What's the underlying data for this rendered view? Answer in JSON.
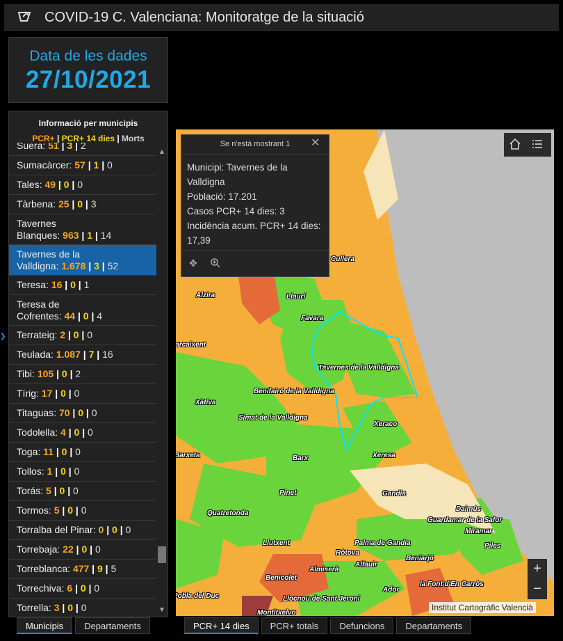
{
  "header": {
    "title": "COVID-19 C. Valenciana: Monitoratge de la situació",
    "logo_icon": "sword-icon"
  },
  "date_card": {
    "label": "Data de les dades",
    "value": "27/10/2021"
  },
  "panel": {
    "title": "Informació per municipis",
    "legend": {
      "pcr": "PCR+",
      "pcr14": "PCR+ 14 dies",
      "morts": "Morts",
      "sep": " | "
    },
    "rows": [
      {
        "name": "Suera",
        "a": "51",
        "b": "3",
        "c": "2",
        "two_line": false,
        "selected": false
      },
      {
        "name": "Sumacàrcer",
        "a": "57",
        "b": "1",
        "c": "0",
        "two_line": false,
        "selected": false
      },
      {
        "name": "Tales",
        "a": "49",
        "b": "0",
        "c": "0",
        "two_line": false,
        "selected": false
      },
      {
        "name": "Tàrbena",
        "a": "25",
        "b": "0",
        "c": "3",
        "two_line": false,
        "selected": false
      },
      {
        "name": "Tavernes\nBlanques",
        "a": "963",
        "b": "1",
        "c": "14",
        "two_line": true,
        "selected": false
      },
      {
        "name": "Tavernes de la\nValldigna",
        "a": "1.678",
        "b": "3",
        "c": "52",
        "two_line": true,
        "selected": true
      },
      {
        "name": "Teresa",
        "a": "16",
        "b": "0",
        "c": "1",
        "two_line": false,
        "selected": false
      },
      {
        "name": "Teresa de\nCofrentes",
        "a": "44",
        "b": "0",
        "c": "4",
        "two_line": true,
        "selected": false
      },
      {
        "name": "Terrateig",
        "a": "2",
        "b": "0",
        "c": "0",
        "two_line": false,
        "selected": false
      },
      {
        "name": "Teulada",
        "a": "1.087",
        "b": "7",
        "c": "16",
        "two_line": false,
        "selected": false
      },
      {
        "name": "Tibi",
        "a": "105",
        "b": "0",
        "c": "2",
        "two_line": false,
        "selected": false
      },
      {
        "name": "Tírig",
        "a": "17",
        "b": "0",
        "c": "0",
        "two_line": false,
        "selected": false
      },
      {
        "name": "Titaguas",
        "a": "70",
        "b": "0",
        "c": "0",
        "two_line": false,
        "selected": false
      },
      {
        "name": "Todolella",
        "a": "4",
        "b": "0",
        "c": "0",
        "two_line": false,
        "selected": false
      },
      {
        "name": "Toga",
        "a": "11",
        "b": "0",
        "c": "0",
        "two_line": false,
        "selected": false
      },
      {
        "name": "Tollos",
        "a": "1",
        "b": "0",
        "c": "0",
        "two_line": false,
        "selected": false
      },
      {
        "name": "Torás",
        "a": "5",
        "b": "0",
        "c": "0",
        "two_line": false,
        "selected": false
      },
      {
        "name": "Tormos",
        "a": "5",
        "b": "0",
        "c": "0",
        "two_line": false,
        "selected": false
      },
      {
        "name": "Torralba del Pinar",
        "a": "0",
        "b": "0",
        "c": "0",
        "two_line": false,
        "selected": false
      },
      {
        "name": "Torrebaja",
        "a": "22",
        "b": "0",
        "c": "0",
        "two_line": false,
        "selected": false
      },
      {
        "name": "Torreblanca",
        "a": "477",
        "b": "9",
        "c": "5",
        "two_line": false,
        "selected": false
      },
      {
        "name": "Torrechiva",
        "a": "6",
        "b": "0",
        "c": "0",
        "two_line": false,
        "selected": false
      },
      {
        "name": "Torrella",
        "a": "3",
        "b": "0",
        "c": "0",
        "two_line": false,
        "selected": false
      }
    ]
  },
  "left_tabs": [
    "Municipis",
    "Departaments"
  ],
  "map_tabs": [
    "PCR+ 14 dies",
    "PCR+ totals",
    "Defuncions",
    "Departaments"
  ],
  "popup": {
    "title": "Se n'està mostrant 1",
    "lines": [
      "Municipi: Tavernes de la Valldigna",
      "Població: 17.201",
      "Casos PCR+ 14 dies: 3",
      "Incidència acum. PCR+ 14 dies: 17,39"
    ]
  },
  "map": {
    "attribution": "Institut Cartogràfic Valencià",
    "zoom_in": "+",
    "zoom_out": "−",
    "labels": [
      "Cullera",
      "Alzira",
      "Llaurí",
      "Favara",
      "Carcaixent",
      "Tavernes de la Valldigna",
      "Benifairó de la Valldigna",
      "Xàtiva",
      "Simat de la Valldigna",
      "Xeraco",
      "Barxeta",
      "Barx",
      "Xeresa",
      "Pinet",
      "Gandia",
      "Quatretonda",
      "Daimús",
      "Guardamar de la Safor",
      "Miramar",
      "Llutxent",
      "Palma de Gandia",
      "Piles",
      "Ròtova",
      "Beniarjó",
      "Alfauir",
      "Almiserà",
      "Benicolet",
      "la Font d'En Carròs",
      "Ador",
      "Pobla del Duc",
      "Llocnou de Sant Jeroni",
      "Montitxelvo"
    ],
    "colors": {
      "green": "#6ad43c",
      "orange": "#f6ae3a",
      "red": "#e46a3a",
      "sand": "#f5e5b8",
      "sea": "#bdbdbd",
      "highlight": "#00e5ff"
    }
  }
}
